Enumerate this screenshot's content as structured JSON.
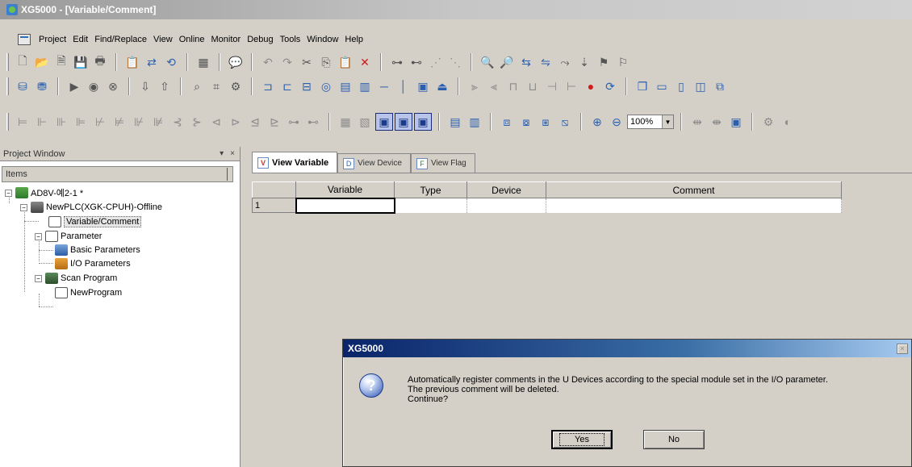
{
  "window": {
    "title": "XG5000 - [Variable/Comment]"
  },
  "menu": {
    "items": [
      "Project",
      "Edit",
      "Find/Replace",
      "View",
      "Online",
      "Monitor",
      "Debug",
      "Tools",
      "Window",
      "Help"
    ]
  },
  "toolbar": {
    "zoom": "100%"
  },
  "project_window": {
    "title": "Project Window",
    "pin": "▾",
    "close": "×",
    "items_header": "Items",
    "tree": [
      {
        "label": "AD8V-예2-1 *",
        "icon": "project-icon"
      },
      {
        "label": "NewPLC(XGK-CPUH)-Offline",
        "icon": "plc-icon"
      },
      {
        "label": "Variable/Comment",
        "icon": "variable-comment-icon"
      },
      {
        "label": "Parameter",
        "icon": "parameter-icon"
      },
      {
        "label": "Basic Parameters",
        "icon": "basic-parameters-icon"
      },
      {
        "label": "I/O Parameters",
        "icon": "io-parameters-icon"
      },
      {
        "label": "Scan Program",
        "icon": "scan-program-icon"
      },
      {
        "label": "NewProgram",
        "icon": "program-icon"
      }
    ]
  },
  "tabs": [
    {
      "label": "View Variable",
      "icon": "V"
    },
    {
      "label": "View Device",
      "icon": "D"
    },
    {
      "label": "View Flag",
      "icon": "F"
    }
  ],
  "grid": {
    "columns": [
      "Variable",
      "Type",
      "Device",
      "Comment"
    ],
    "rows": [
      {
        "num": "1",
        "variable": "",
        "type": "",
        "device": "",
        "comment": ""
      }
    ]
  },
  "dialog": {
    "title": "XG5000",
    "close": "×",
    "icon": "question-icon",
    "line1": "Automatically register comments in the U Devices according to the special module set in the I/O parameter.",
    "line2": "The previous comment will be deleted.",
    "line3": "Continue?",
    "yes": "Yes",
    "no": "No"
  }
}
